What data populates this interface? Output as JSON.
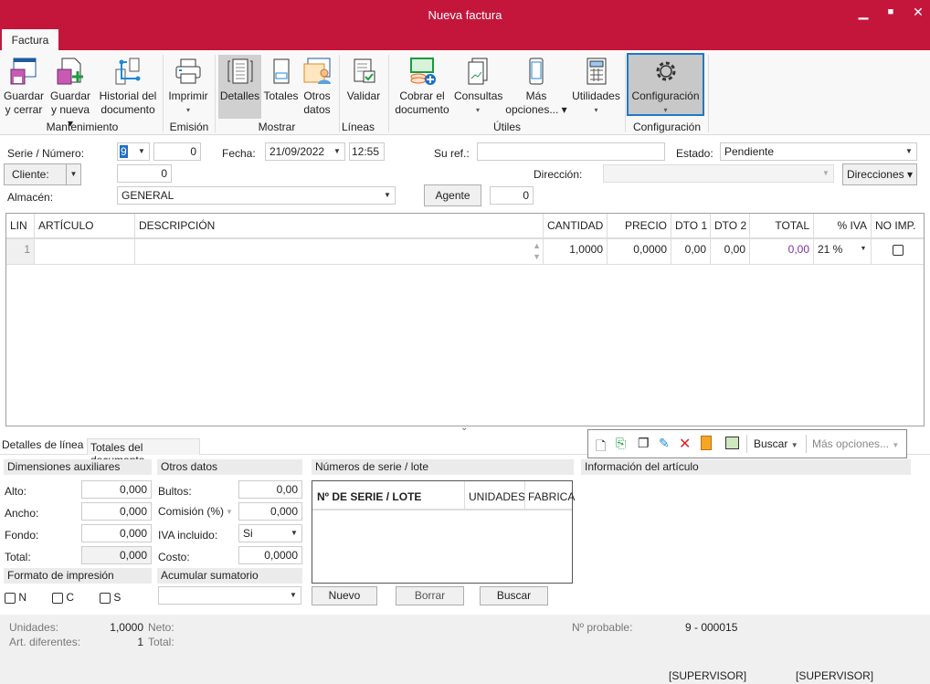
{
  "window": {
    "title": "Nueva factura",
    "minimize": "▁",
    "maximize": "■",
    "close": "✕"
  },
  "ribbon": {
    "tab": "Factura",
    "buttons": [
      {
        "label1": "Guardar",
        "label2": "y cerrar"
      },
      {
        "label1": "Guardar",
        "label2": "y nueva ▾"
      },
      {
        "label1": "Historial del",
        "label2": "documento"
      },
      {
        "label1": "Imprimir",
        "label2": "▾"
      },
      {
        "label1": "Detalles",
        "label2": "",
        "active": true
      },
      {
        "label1": "Totales",
        "label2": ""
      },
      {
        "label1": "Otros",
        "label2": "datos"
      },
      {
        "label1": "Validar",
        "label2": ""
      },
      {
        "label1": "Cobrar el",
        "label2": "documento"
      },
      {
        "label1": "Consultas",
        "label2": "▾"
      },
      {
        "label1": "Más",
        "label2": "opciones... ▾"
      },
      {
        "label1": "Utilidades",
        "label2": "▾"
      },
      {
        "label1": "Configuración",
        "label2": "▾",
        "selected": true
      }
    ],
    "groups": [
      "Mantenimiento",
      "Emisión",
      "Mostrar",
      "Líneas",
      "Útiles",
      "Configuración"
    ]
  },
  "header": {
    "serie_label": "Serie / Número:",
    "serie": "9",
    "numero": "0",
    "fecha_label": "Fecha:",
    "fecha": "21/09/2022",
    "hora": "12:55",
    "suref_label": "Su ref.:",
    "suref": "",
    "estado_label": "Estado:",
    "estado": "Pendiente",
    "cliente_label": "Cliente:",
    "cliente": "0",
    "direccion_label": "Dirección:",
    "direccion": "",
    "direcciones_button": "Direcciones ▾",
    "almacen_label": "Almacén:",
    "almacen": "GENERAL",
    "agente_button": "Agente",
    "agente": "0"
  },
  "grid": {
    "columns": [
      "LIN",
      "ARTÍCULO",
      "DESCRIPCIÓN",
      "CANTIDAD",
      "PRECIO",
      "DTO 1",
      "DTO 2",
      "TOTAL",
      "% IVA",
      "NO IMP."
    ],
    "rows": [
      {
        "lin": "1",
        "articulo": "",
        "descripcion": "",
        "cantidad": "1,0000",
        "precio": "0,0000",
        "dto1": "0,00",
        "dto2": "0,00",
        "total": "0,00",
        "iva": "21 %",
        "noimp": false
      }
    ]
  },
  "bottom_tabs": [
    "Detalles de línea",
    "Totales del documento"
  ],
  "toolbar": {
    "buscar": "Buscar",
    "mas_opciones": "Más opciones..."
  },
  "dimensiones": {
    "title": "Dimensiones auxiliares",
    "alto_label": "Alto:",
    "alto": "0,000",
    "ancho_label": "Ancho:",
    "ancho": "0,000",
    "fondo_label": "Fondo:",
    "fondo": "0,000",
    "total_label": "Total:",
    "total": "0,000"
  },
  "otros": {
    "title": "Otros datos",
    "bultos_label": "Bultos:",
    "bultos": "0,00",
    "comision_label": "Comisión (%)",
    "comision": "0,000",
    "iva_label": "IVA incluido:",
    "iva": "Si",
    "costo_label": "Costo:",
    "costo": "0,0000"
  },
  "formato": {
    "title": "Formato de impresión",
    "options": [
      "N",
      "C",
      "S"
    ]
  },
  "acumular": {
    "title": "Acumular sumatorio",
    "value": ""
  },
  "serie_lote": {
    "title": "Números de serie / lote",
    "columns": [
      "Nº DE SERIE / LOTE",
      "UNIDADES",
      "FABRICA"
    ],
    "nuevo": "Nuevo",
    "borrar": "Borrar",
    "buscar": "Buscar"
  },
  "info": {
    "title": "Información del artículo"
  },
  "status": {
    "unidades_label": "Unidades:",
    "unidades": "1,0000",
    "neto_label": "Neto:",
    "art_label": "Art. diferentes:",
    "art": "1",
    "total_label": "Total:",
    "probable_label": "Nº probable:",
    "probable": "9 - 000015",
    "user1": "[SUPERVISOR]",
    "user2": "[SUPERVISOR]"
  }
}
